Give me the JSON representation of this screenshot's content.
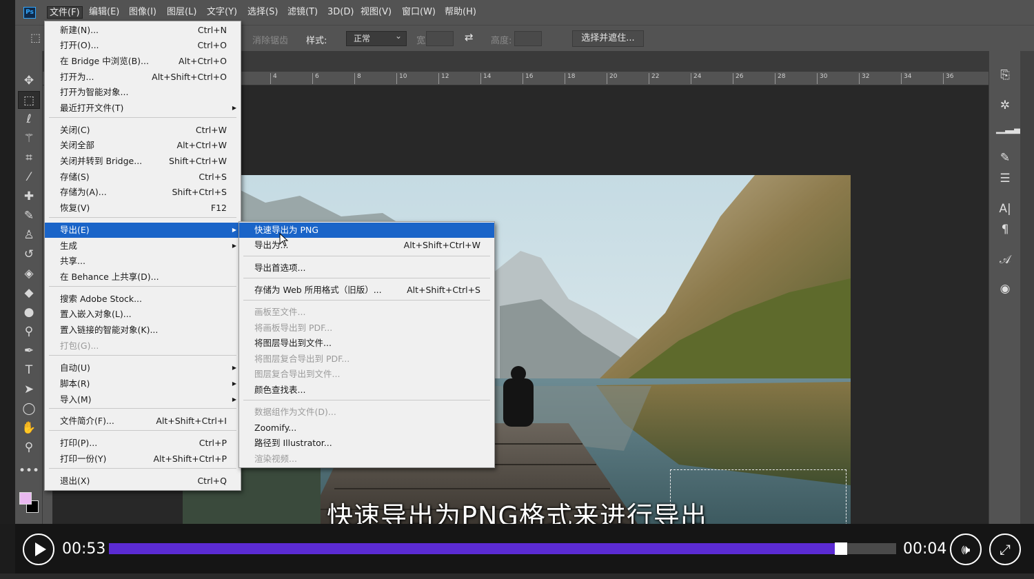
{
  "app": {
    "logo": "Ps"
  },
  "menubar": [
    "文件(F)",
    "编辑(E)",
    "图像(I)",
    "图层(L)",
    "文字(Y)",
    "选择(S)",
    "滤镜(T)",
    "3D(D)",
    "视图(V)",
    "窗口(W)",
    "帮助(H)"
  ],
  "options_bar": {
    "antialias_label": "消除锯齿",
    "style_label": "样式:",
    "style_value": "正常",
    "width_label": "宽度:",
    "height_label": "高度:",
    "select_mask_button": "选择并遮住..."
  },
  "ruler_ticks": [
    "4",
    "6",
    "8",
    "10",
    "12",
    "14",
    "16",
    "18",
    "20",
    "22",
    "24",
    "26",
    "28",
    "30",
    "32",
    "34",
    "36"
  ],
  "file_menu": {
    "items": [
      {
        "label": "新建(N)...",
        "shortcut": "Ctrl+N"
      },
      {
        "label": "打开(O)...",
        "shortcut": "Ctrl+O"
      },
      {
        "label": "在 Bridge 中浏览(B)...",
        "shortcut": "Alt+Ctrl+O"
      },
      {
        "label": "打开为...",
        "shortcut": "Alt+Shift+Ctrl+O"
      },
      {
        "label": "打开为智能对象...",
        "shortcut": ""
      },
      {
        "label": "最近打开文件(T)",
        "shortcut": "",
        "submenu": true
      },
      {
        "label": "关闭(C)",
        "shortcut": "Ctrl+W"
      },
      {
        "label": "关闭全部",
        "shortcut": "Alt+Ctrl+W"
      },
      {
        "label": "关闭并转到 Bridge...",
        "shortcut": "Shift+Ctrl+W"
      },
      {
        "label": "存储(S)",
        "shortcut": "Ctrl+S"
      },
      {
        "label": "存储为(A)...",
        "shortcut": "Shift+Ctrl+S"
      },
      {
        "label": "恢复(V)",
        "shortcut": "F12"
      },
      {
        "label": "导出(E)",
        "shortcut": "",
        "submenu": true,
        "highlight": true
      },
      {
        "label": "生成",
        "shortcut": "",
        "submenu": true
      },
      {
        "label": "共享...",
        "shortcut": ""
      },
      {
        "label": "在 Behance 上共享(D)...",
        "shortcut": ""
      },
      {
        "label": "搜索 Adobe Stock...",
        "shortcut": ""
      },
      {
        "label": "置入嵌入对象(L)...",
        "shortcut": ""
      },
      {
        "label": "置入链接的智能对象(K)...",
        "shortcut": ""
      },
      {
        "label": "打包(G)...",
        "shortcut": "",
        "disabled": true
      },
      {
        "label": "自动(U)",
        "shortcut": "",
        "submenu": true
      },
      {
        "label": "脚本(R)",
        "shortcut": "",
        "submenu": true
      },
      {
        "label": "导入(M)",
        "shortcut": "",
        "submenu": true
      },
      {
        "label": "文件简介(F)...",
        "shortcut": "Alt+Shift+Ctrl+I"
      },
      {
        "label": "打印(P)...",
        "shortcut": "Ctrl+P"
      },
      {
        "label": "打印一份(Y)",
        "shortcut": "Alt+Shift+Ctrl+P"
      },
      {
        "label": "退出(X)",
        "shortcut": "Ctrl+Q"
      }
    ]
  },
  "export_menu": {
    "items": [
      {
        "label": "快速导出为 PNG",
        "shortcut": "",
        "highlight": true
      },
      {
        "label": "导出为...",
        "shortcut": "Alt+Shift+Ctrl+W"
      },
      {
        "label": "导出首选项...",
        "shortcut": ""
      },
      {
        "label": "存储为 Web 所用格式（旧版）...",
        "shortcut": "Alt+Shift+Ctrl+S"
      },
      {
        "label": "画板至文件...",
        "shortcut": "",
        "disabled": true
      },
      {
        "label": "将画板导出到 PDF...",
        "shortcut": "",
        "disabled": true
      },
      {
        "label": "将图层导出到文件...",
        "shortcut": ""
      },
      {
        "label": "将图层复合导出到 PDF...",
        "shortcut": "",
        "disabled": true
      },
      {
        "label": "图层复合导出到文件...",
        "shortcut": "",
        "disabled": true
      },
      {
        "label": "颜色查找表...",
        "shortcut": ""
      },
      {
        "label": "数据组作为文件(D)...",
        "shortcut": "",
        "disabled": true
      },
      {
        "label": "Zoomify...",
        "shortcut": ""
      },
      {
        "label": "路径到 Illustrator...",
        "shortcut": ""
      },
      {
        "label": "渲染视频...",
        "shortcut": "",
        "disabled": true
      }
    ]
  },
  "subtitle": "快速导出为PNG格式来进行导出",
  "player": {
    "elapsed": "00:53",
    "remaining": "00:04",
    "progress": 0.93,
    "accent": "#5b2bd3"
  }
}
